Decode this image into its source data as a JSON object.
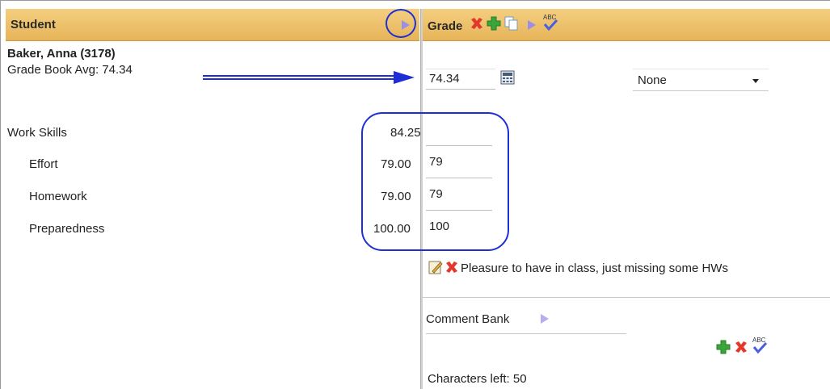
{
  "left_header": {
    "title": "Student"
  },
  "right_header": {
    "title": "Grade"
  },
  "student": {
    "name": "Baker, Anna (3178)",
    "grade_book_avg": "Grade Book Avg: 74.34"
  },
  "grade": {
    "value": "74.34",
    "dropdown_selected": "None"
  },
  "rows": [
    {
      "label": "Work Skills",
      "score": "84.25",
      "entry": ""
    },
    {
      "label": "Effort",
      "score": "79.00",
      "entry": "79"
    },
    {
      "label": "Homework",
      "score": "79.00",
      "entry": "79"
    },
    {
      "label": "Preparedness",
      "score": "100.00",
      "entry": "100"
    }
  ],
  "comment": {
    "text": "Pleasure to have in class, just missing some HWs"
  },
  "comment_bank": {
    "label": "Comment Bank"
  },
  "characters_left": {
    "text": "Characters left: 50"
  },
  "colors": {
    "header_top": "#f4cf80",
    "header_bottom": "#e6b459",
    "annotation": "#1f2fd6",
    "delete_red": "#e2382e",
    "add_green": "#3aa63a"
  }
}
